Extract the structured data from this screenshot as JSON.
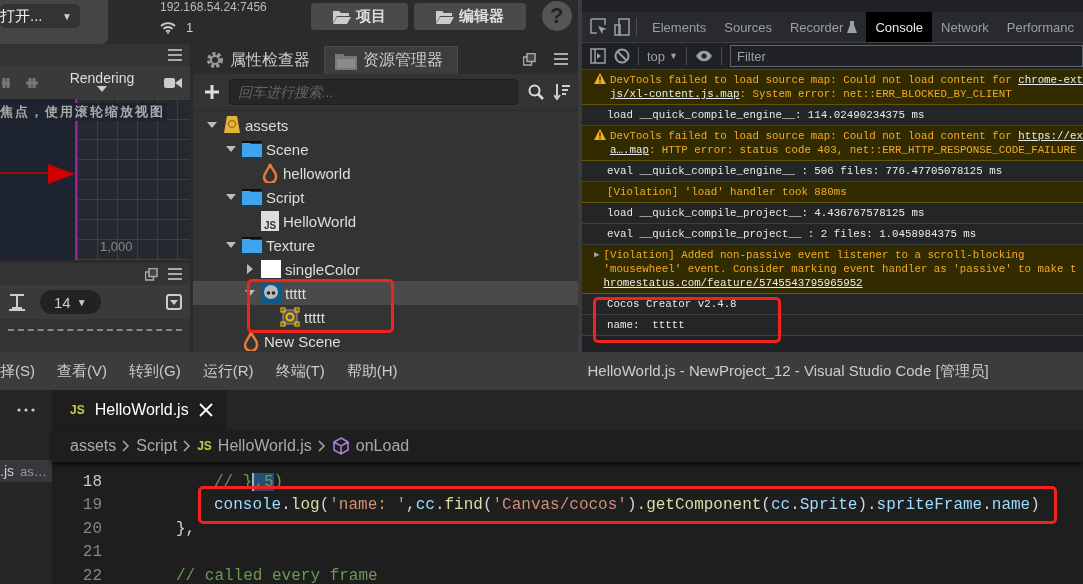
{
  "cocos": {
    "open_menu": {
      "label": "打开...",
      "caret": "▼"
    },
    "server_address": "192.168.54.24:7456",
    "device_count": "1",
    "buttons": [
      "项目",
      "编辑器"
    ],
    "help": "?",
    "scene": {
      "render_mode": "Rendering",
      "hint": "焦点，使用滚轮缩放视图",
      "ruler_label": "1,000"
    },
    "console_toolbar": {
      "font_size": "14",
      "caret": "▼"
    },
    "assets": {
      "tabs": [
        {
          "label": "属性检查器",
          "selected": false
        },
        {
          "label": "资源管理器",
          "selected": true
        }
      ],
      "search_placeholder": "回车进行搜索...",
      "tree": [
        {
          "name": "assets",
          "kind": "db",
          "expanded": true,
          "selected": false,
          "children": [
            {
              "name": "Scene",
              "kind": "folder",
              "expanded": true,
              "selected": false,
              "children": [
                {
                  "name": "helloworld",
                  "kind": "scene",
                  "selected": false
                }
              ]
            },
            {
              "name": "Script",
              "kind": "folder",
              "expanded": true,
              "selected": false,
              "children": [
                {
                  "name": "HelloWorld",
                  "kind": "script",
                  "icon_text": "JS",
                  "selected": false
                }
              ]
            },
            {
              "name": "Texture",
              "kind": "folder",
              "expanded": true,
              "selected": false,
              "children": [
                {
                  "name": "singleColor",
                  "kind": "texture",
                  "expanded": false,
                  "selected": false
                },
                {
                  "name": "ttttt",
                  "kind": "image",
                  "expanded": true,
                  "selected": true,
                  "children": [
                    {
                      "name": "ttttt",
                      "kind": "sprite-frame",
                      "selected": false
                    }
                  ]
                }
              ]
            },
            {
              "name": "New Scene",
              "kind": "scene",
              "selected": false
            }
          ]
        }
      ]
    }
  },
  "devtools": {
    "tabs": [
      {
        "label": "Elements",
        "kind": "plain",
        "selected": false
      },
      {
        "label": "Sources",
        "kind": "plain",
        "selected": false
      },
      {
        "label": "Recorder",
        "kind": "experimental",
        "selected": false
      },
      {
        "label": "Console",
        "kind": "plain",
        "selected": true
      },
      {
        "label": "Network",
        "kind": "plain",
        "selected": false
      },
      {
        "label": "Performanc",
        "kind": "plain",
        "selected": false
      }
    ],
    "context": "top",
    "context_caret": "▼",
    "filter_placeholder": "Filter",
    "messages": [
      {
        "kind": "warning",
        "lines": [
          [
            {
              "text": "DevTools failed to load source map: Could not load content for ",
              "kind": "text"
            },
            {
              "text": "chrome-ext",
              "kind": "link"
            }
          ],
          [
            {
              "text": "js/xl-content.js.map",
              "kind": "link"
            },
            {
              "text": ": System error: net::ERR_BLOCKED_BY_CLIENT",
              "kind": "text"
            }
          ]
        ]
      },
      {
        "kind": "log",
        "lines": [
          [
            {
              "text": "load __quick_compile_engine__: 114.02490234375 ms",
              "kind": "text"
            }
          ]
        ]
      },
      {
        "kind": "warning",
        "lines": [
          [
            {
              "text": "DevTools failed to load source map: Could not load content for ",
              "kind": "text"
            },
            {
              "text": "https://ex",
              "kind": "link"
            }
          ],
          [
            {
              "text": "a….map",
              "kind": "link"
            },
            {
              "text": ": HTTP error: status code 403, net::ERR_HTTP_RESPONSE_CODE_FAILURE",
              "kind": "text"
            }
          ]
        ]
      },
      {
        "kind": "log",
        "lines": [
          [
            {
              "text": "eval __quick_compile_engine__ : 506 files: 776.47705078125 ms",
              "kind": "text"
            }
          ]
        ]
      },
      {
        "kind": "violation",
        "lines": [
          [
            {
              "text": "[Violation] 'load' handler took 880ms",
              "kind": "text"
            }
          ]
        ]
      },
      {
        "kind": "log",
        "lines": [
          [
            {
              "text": "load __quick_compile_project__: 4.436767578125 ms",
              "kind": "text"
            }
          ]
        ]
      },
      {
        "kind": "log",
        "lines": [
          [
            {
              "text": "eval __quick_compile_project__ : 2 files: 1.0458984375 ms",
              "kind": "text"
            }
          ]
        ]
      },
      {
        "kind": "violation",
        "toggle": "▶",
        "lines": [
          [
            {
              "text": "[Violation] Added non-passive event listener to a scroll-blocking",
              "kind": "text"
            }
          ],
          [
            {
              "text": "'mousewheel' event. Consider marking event handler as 'passive' to make t",
              "kind": "text"
            }
          ],
          [
            {
              "text": "hromestatus.com/feature/5745543795965952",
              "kind": "link"
            }
          ]
        ]
      },
      {
        "kind": "log",
        "lines": [
          [
            {
              "text": "Cocos Creator v2.4.8",
              "kind": "text"
            }
          ]
        ]
      },
      {
        "kind": "log",
        "lines": [
          [
            {
              "text": "name:  ttttt",
              "kind": "text"
            }
          ]
        ]
      }
    ]
  },
  "vscode": {
    "menu": [
      "择(S)",
      "查看(V)",
      "转到(G)",
      "运行(R)",
      "终端(T)",
      "帮助(H)"
    ],
    "title": "HelloWorld.js - NewProject_12 - Visual Studio Code [管理员]",
    "open_editor": {
      "name": ".js",
      "path": "as…"
    },
    "tab": {
      "icon_text": "JS",
      "label": "HelloWorld.js"
    },
    "breadcrumbs": [
      {
        "label": "assets",
        "kind": "folder"
      },
      {
        "label": "Script",
        "kind": "folder"
      },
      {
        "label": "HelloWorld.js",
        "kind": "file",
        "icon_text": "JS"
      },
      {
        "label": "onLoad",
        "kind": "method"
      }
    ],
    "code": [
      {
        "number": "18",
        "current": true,
        "kind": "inner",
        "tokens": [
          {
            "text": "// }",
            "kind": "comment"
          },
          {
            "text": ",5",
            "kind": "comment-selected"
          },
          {
            "text": ")",
            "kind": "comment"
          }
        ]
      },
      {
        "number": "19",
        "current": false,
        "highlighted": true,
        "kind": "inner",
        "tokens": [
          {
            "text": "console",
            "kind": "variable"
          },
          {
            "text": ".",
            "kind": "plain"
          },
          {
            "text": "log",
            "kind": "function"
          },
          {
            "text": "(",
            "kind": "plain"
          },
          {
            "text": "'name: '",
            "kind": "string"
          },
          {
            "text": ",",
            "kind": "plain"
          },
          {
            "text": "cc",
            "kind": "variable"
          },
          {
            "text": ".",
            "kind": "plain"
          },
          {
            "text": "find",
            "kind": "function"
          },
          {
            "text": "(",
            "kind": "plain"
          },
          {
            "text": "'Canvas/cocos'",
            "kind": "string"
          },
          {
            "text": ").",
            "kind": "plain"
          },
          {
            "text": "getComponent",
            "kind": "function"
          },
          {
            "text": "(",
            "kind": "plain"
          },
          {
            "text": "cc",
            "kind": "variable"
          },
          {
            "text": ".",
            "kind": "plain"
          },
          {
            "text": "Sprite",
            "kind": "variable"
          },
          {
            "text": ").",
            "kind": "plain"
          },
          {
            "text": "spriteFrame",
            "kind": "variable"
          },
          {
            "text": ".",
            "kind": "plain"
          },
          {
            "text": "name",
            "kind": "variable"
          },
          {
            "text": ")",
            "kind": "plain"
          }
        ]
      },
      {
        "number": "20",
        "current": false,
        "kind": "outer",
        "tokens": [
          {
            "text": "},",
            "kind": "plain"
          }
        ]
      },
      {
        "number": "21",
        "current": false
      },
      {
        "number": "22",
        "current": false,
        "kind": "outer",
        "tokens": [
          {
            "text": "// called every frame",
            "kind": "comment"
          }
        ]
      }
    ]
  }
}
